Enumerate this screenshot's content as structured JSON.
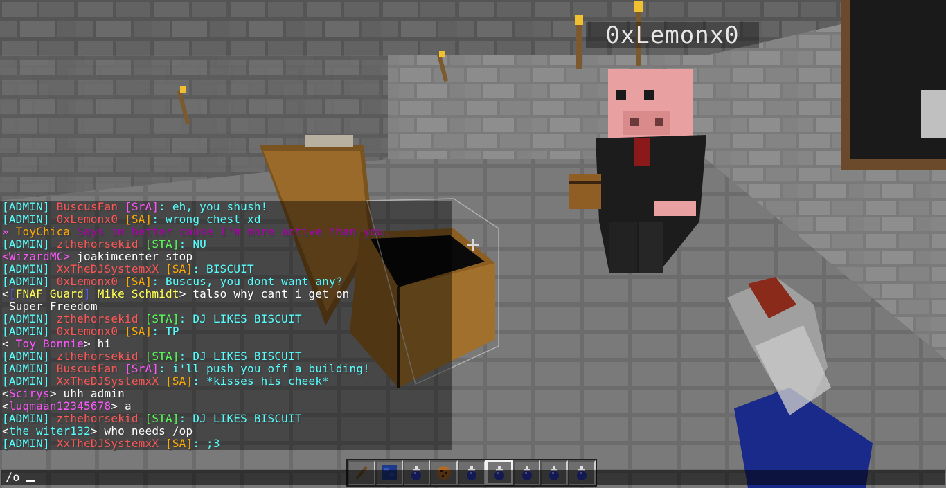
{
  "colors": {
    "white": "#ffffff",
    "gray": "#aaaaaa",
    "red": "#ff5555",
    "pink": "#ff55ff",
    "aqua": "#55ffff",
    "green": "#55ff55",
    "yellow": "#ffff55",
    "gold": "#ffaa00",
    "blue": "#5555ff",
    "purple": "#aa00aa"
  },
  "nametag": "0xLemonx0",
  "chat": [
    [
      [
        "[ADMIN] ",
        "#55ffff"
      ],
      [
        "BuscusFan ",
        "#ff5555"
      ],
      [
        "[SrA]",
        "#ff55ff"
      ],
      [
        ": eh, you shush!",
        "#55ffff"
      ]
    ],
    [
      [
        "[ADMIN] ",
        "#55ffff"
      ],
      [
        "0xLemonx0 ",
        "#ff5555"
      ],
      [
        "[SA]",
        "#ffaa00"
      ],
      [
        ": wrong chest xd",
        "#55ffff"
      ]
    ],
    [
      [
        "» ",
        "#ff55ff"
      ],
      [
        "ToyChica ",
        "#ffaa00"
      ],
      [
        "Says im better cause I'm more active than you.",
        "#aa00aa"
      ]
    ],
    [
      [
        "[ADMIN] ",
        "#55ffff"
      ],
      [
        "zthehorsekid ",
        "#ff5555"
      ],
      [
        "[STA]",
        "#55ff55"
      ],
      [
        ": NU",
        "#55ffff"
      ]
    ],
    [
      [
        "<WizardMC> ",
        "#ff55ff"
      ],
      [
        "joakimcenter stop",
        "#ffffff"
      ]
    ],
    [
      [
        "[ADMIN] ",
        "#55ffff"
      ],
      [
        "XxTheDJSystemxX ",
        "#ff5555"
      ],
      [
        "[SA]",
        "#ffaa00"
      ],
      [
        ": BISCUIT",
        "#55ffff"
      ]
    ],
    [
      [
        "[ADMIN] ",
        "#55ffff"
      ],
      [
        "0xLemonx0 ",
        "#ff5555"
      ],
      [
        "[SA]",
        "#ffaa00"
      ],
      [
        ": Buscus, you dont want any?",
        "#55ffff"
      ]
    ],
    [
      [
        "<",
        "#ffffff"
      ],
      [
        "[",
        "#5555ff"
      ],
      [
        "FNAF Guard",
        "#ffff55"
      ],
      [
        "] ",
        "#5555ff"
      ],
      [
        "Mike_Schmidt",
        "#ffff55"
      ],
      [
        "> talso why cant i get on",
        "#ffffff"
      ]
    ],
    [
      [
        " Super Freedom",
        "#ffffff"
      ]
    ],
    [
      [
        "[ADMIN] ",
        "#55ffff"
      ],
      [
        "zthehorsekid ",
        "#ff5555"
      ],
      [
        "[STA]",
        "#55ff55"
      ],
      [
        ": DJ LIKES BISCUIT",
        "#55ffff"
      ]
    ],
    [
      [
        "[ADMIN] ",
        "#55ffff"
      ],
      [
        "0xLemonx0 ",
        "#ff5555"
      ],
      [
        "[SA]",
        "#ffaa00"
      ],
      [
        ": TP",
        "#55ffff"
      ]
    ],
    [
      [
        "< ",
        "#ffffff"
      ],
      [
        "Toy_Bonnie",
        "#ff55ff"
      ],
      [
        "> hi",
        "#ffffff"
      ]
    ],
    [
      [
        "[ADMIN] ",
        "#55ffff"
      ],
      [
        "zthehorsekid ",
        "#ff5555"
      ],
      [
        "[STA]",
        "#55ff55"
      ],
      [
        ": DJ LIKES BISCUIT",
        "#55ffff"
      ]
    ],
    [
      [
        "[ADMIN] ",
        "#55ffff"
      ],
      [
        "BuscusFan ",
        "#ff5555"
      ],
      [
        "[SrA]",
        "#ff55ff"
      ],
      [
        ": i'll push you off a building!",
        "#55ffff"
      ]
    ],
    [
      [
        "[ADMIN] ",
        "#55ffff"
      ],
      [
        "XxTheDJSystemxX ",
        "#ff5555"
      ],
      [
        "[SA]",
        "#ffaa00"
      ],
      [
        ": *kisses his cheek*",
        "#55ffff"
      ]
    ],
    [
      [
        "<",
        "#ffffff"
      ],
      [
        "Scirys",
        "#ff55ff"
      ],
      [
        "> uhh admin",
        "#ffffff"
      ]
    ],
    [
      [
        "<",
        "#ffffff"
      ],
      [
        "luqmaan12345678",
        "#ff55ff"
      ],
      [
        "> a",
        "#ffffff"
      ]
    ],
    [
      [
        "[ADMIN] ",
        "#55ffff"
      ],
      [
        "zthehorsekid ",
        "#ff5555"
      ],
      [
        "[STA]",
        "#55ff55"
      ],
      [
        ": DJ LIKES BISCUIT",
        "#55ffff"
      ]
    ],
    [
      [
        "<",
        "#ffffff"
      ],
      [
        "the_witer132",
        "#55ffff"
      ],
      [
        "> who needs /op",
        "#ffffff"
      ]
    ],
    [
      [
        "[ADMIN] ",
        "#55ffff"
      ],
      [
        "XxTheDJSystemxX ",
        "#ff5555"
      ],
      [
        "[SA]",
        "#ffaa00"
      ],
      [
        ": ;3",
        "#55ffff"
      ]
    ]
  ],
  "command_input": "/o",
  "hotbar": {
    "selected_slot": 6,
    "slots": [
      "stick",
      "lapis-block",
      "splash-potion",
      "cookie",
      "splash-potion",
      "splash-potion",
      "splash-potion",
      "splash-potion",
      "splash-potion"
    ]
  }
}
